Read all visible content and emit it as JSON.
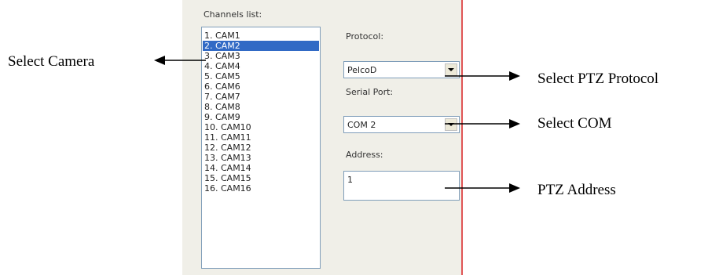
{
  "channels": {
    "label": "Channels list:",
    "selected_index": 1,
    "items": [
      "1. CAM1",
      "2. CAM2",
      "3. CAM3",
      "4. CAM4",
      "5. CAM5",
      "6. CAM6",
      "7. CAM7",
      "8. CAM8",
      "9. CAM9",
      "10. CAM10",
      "11. CAM11",
      "12. CAM12",
      "13. CAM13",
      "14. CAM14",
      "15. CAM15",
      "16. CAM16"
    ]
  },
  "protocol": {
    "label": "Protocol:",
    "value": "PelcoD"
  },
  "serial_port": {
    "label": "Serial Port:",
    "value": "COM 2"
  },
  "address": {
    "label": "Address:",
    "value": "1"
  },
  "annotations": {
    "select_camera": "Select Camera",
    "select_ptz_protocol": "Select PTZ Protocol",
    "select_com": "Select COM",
    "ptz_address": "PTZ Address"
  },
  "colors": {
    "selection": "#316ac5",
    "divider": "#e05555",
    "panel": "#f0efe8"
  }
}
